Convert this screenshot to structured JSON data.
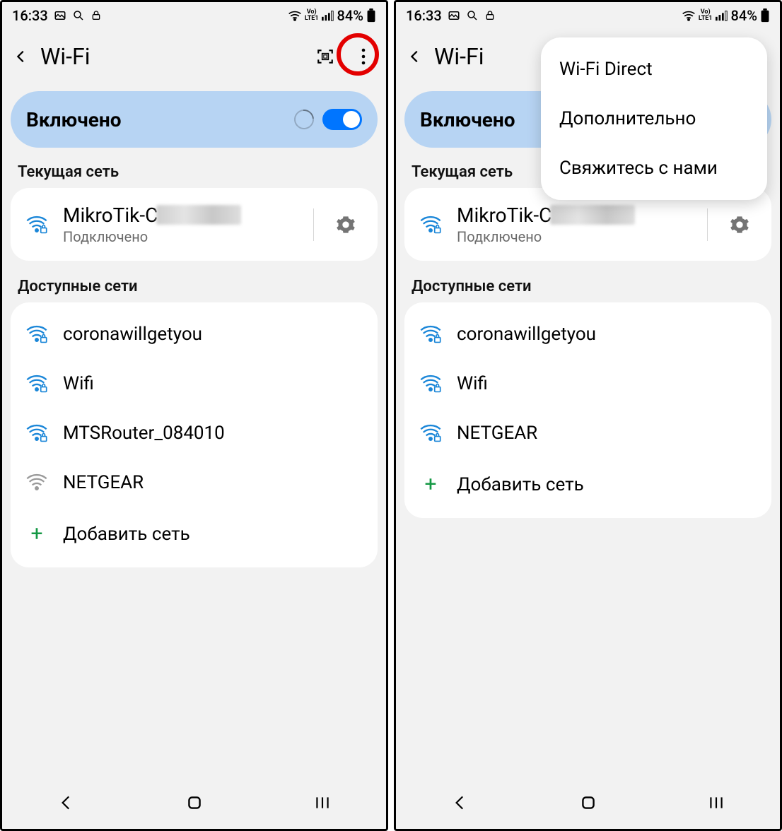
{
  "status": {
    "time": "16:33",
    "battery": "84%"
  },
  "header": {
    "title": "Wi-Fi"
  },
  "toggle": {
    "label": "Включено"
  },
  "sections": {
    "current": "Текущая сеть",
    "available": "Доступные сети"
  },
  "current": {
    "name_prefix": "MikroTik-C",
    "status": "Подключено"
  },
  "left_networks": [
    {
      "name": "coronawillgetyou",
      "secure": true
    },
    {
      "name": "Wifi",
      "secure": true
    },
    {
      "name": "MTSRouter_084010",
      "secure": true
    },
    {
      "name": "NETGEAR",
      "secure": false
    }
  ],
  "right_networks": [
    {
      "name": "coronawillgetyou",
      "secure": true
    },
    {
      "name": "Wifi",
      "secure": true
    },
    {
      "name": "NETGEAR",
      "secure": true
    }
  ],
  "add_label": "Добавить сеть",
  "popup": {
    "items": [
      "Wi-Fi Direct",
      "Дополнительно",
      "Свяжитесь с нами"
    ]
  }
}
